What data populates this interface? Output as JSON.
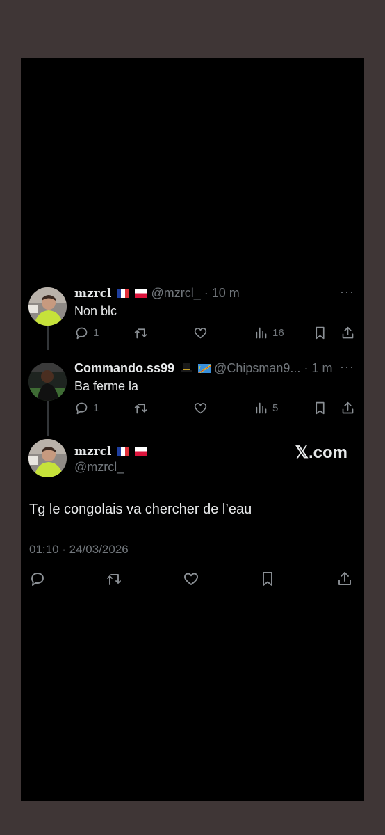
{
  "replies": [
    {
      "name": "mzrcl",
      "handle": "@mzrcl_",
      "time": "· 10 m",
      "text": "Non blc",
      "more": "···",
      "reply_count": "1",
      "retweet_count": "",
      "like_count": "",
      "views_count": "16"
    },
    {
      "name": "Commando.ss99",
      "handle": "@Chipsman9...",
      "time": "· 1 m",
      "text": "Ba ferme la",
      "more": "···",
      "reply_count": "1",
      "retweet_count": "",
      "like_count": "",
      "views_count": "5"
    }
  ],
  "main_tweet": {
    "name": "mzrcl",
    "handle": "@mzrcl_",
    "watermark": "𝕏.com",
    "text": "Tg le congolais va chercher de l’eau",
    "timestamp": "01:10 · 24/03/2026"
  },
  "icons": [
    "reply-icon",
    "retweet-icon",
    "like-icon",
    "views-icon",
    "bookmark-icon",
    "share-icon"
  ],
  "colors": {
    "background": "#000000",
    "frame": "#3f3636",
    "muted": "#71767b",
    "text": "#e7e9ea"
  }
}
